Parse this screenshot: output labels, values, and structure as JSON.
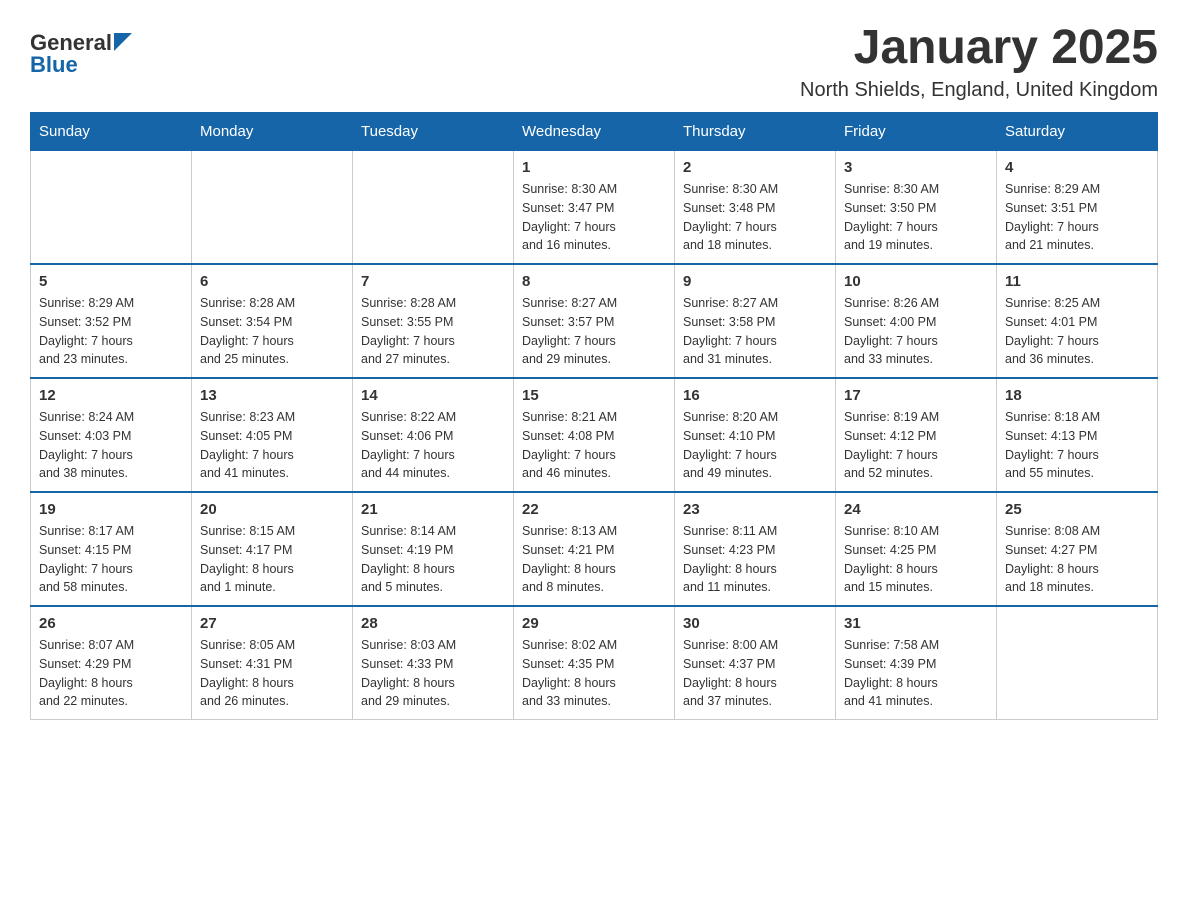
{
  "header": {
    "logo_general": "General",
    "logo_blue": "Blue",
    "title": "January 2025",
    "subtitle": "North Shields, England, United Kingdom"
  },
  "days_of_week": [
    "Sunday",
    "Monday",
    "Tuesday",
    "Wednesday",
    "Thursday",
    "Friday",
    "Saturday"
  ],
  "weeks": [
    [
      {
        "day": "",
        "info": ""
      },
      {
        "day": "",
        "info": ""
      },
      {
        "day": "",
        "info": ""
      },
      {
        "day": "1",
        "info": "Sunrise: 8:30 AM\nSunset: 3:47 PM\nDaylight: 7 hours\nand 16 minutes."
      },
      {
        "day": "2",
        "info": "Sunrise: 8:30 AM\nSunset: 3:48 PM\nDaylight: 7 hours\nand 18 minutes."
      },
      {
        "day": "3",
        "info": "Sunrise: 8:30 AM\nSunset: 3:50 PM\nDaylight: 7 hours\nand 19 minutes."
      },
      {
        "day": "4",
        "info": "Sunrise: 8:29 AM\nSunset: 3:51 PM\nDaylight: 7 hours\nand 21 minutes."
      }
    ],
    [
      {
        "day": "5",
        "info": "Sunrise: 8:29 AM\nSunset: 3:52 PM\nDaylight: 7 hours\nand 23 minutes."
      },
      {
        "day": "6",
        "info": "Sunrise: 8:28 AM\nSunset: 3:54 PM\nDaylight: 7 hours\nand 25 minutes."
      },
      {
        "day": "7",
        "info": "Sunrise: 8:28 AM\nSunset: 3:55 PM\nDaylight: 7 hours\nand 27 minutes."
      },
      {
        "day": "8",
        "info": "Sunrise: 8:27 AM\nSunset: 3:57 PM\nDaylight: 7 hours\nand 29 minutes."
      },
      {
        "day": "9",
        "info": "Sunrise: 8:27 AM\nSunset: 3:58 PM\nDaylight: 7 hours\nand 31 minutes."
      },
      {
        "day": "10",
        "info": "Sunrise: 8:26 AM\nSunset: 4:00 PM\nDaylight: 7 hours\nand 33 minutes."
      },
      {
        "day": "11",
        "info": "Sunrise: 8:25 AM\nSunset: 4:01 PM\nDaylight: 7 hours\nand 36 minutes."
      }
    ],
    [
      {
        "day": "12",
        "info": "Sunrise: 8:24 AM\nSunset: 4:03 PM\nDaylight: 7 hours\nand 38 minutes."
      },
      {
        "day": "13",
        "info": "Sunrise: 8:23 AM\nSunset: 4:05 PM\nDaylight: 7 hours\nand 41 minutes."
      },
      {
        "day": "14",
        "info": "Sunrise: 8:22 AM\nSunset: 4:06 PM\nDaylight: 7 hours\nand 44 minutes."
      },
      {
        "day": "15",
        "info": "Sunrise: 8:21 AM\nSunset: 4:08 PM\nDaylight: 7 hours\nand 46 minutes."
      },
      {
        "day": "16",
        "info": "Sunrise: 8:20 AM\nSunset: 4:10 PM\nDaylight: 7 hours\nand 49 minutes."
      },
      {
        "day": "17",
        "info": "Sunrise: 8:19 AM\nSunset: 4:12 PM\nDaylight: 7 hours\nand 52 minutes."
      },
      {
        "day": "18",
        "info": "Sunrise: 8:18 AM\nSunset: 4:13 PM\nDaylight: 7 hours\nand 55 minutes."
      }
    ],
    [
      {
        "day": "19",
        "info": "Sunrise: 8:17 AM\nSunset: 4:15 PM\nDaylight: 7 hours\nand 58 minutes."
      },
      {
        "day": "20",
        "info": "Sunrise: 8:15 AM\nSunset: 4:17 PM\nDaylight: 8 hours\nand 1 minute."
      },
      {
        "day": "21",
        "info": "Sunrise: 8:14 AM\nSunset: 4:19 PM\nDaylight: 8 hours\nand 5 minutes."
      },
      {
        "day": "22",
        "info": "Sunrise: 8:13 AM\nSunset: 4:21 PM\nDaylight: 8 hours\nand 8 minutes."
      },
      {
        "day": "23",
        "info": "Sunrise: 8:11 AM\nSunset: 4:23 PM\nDaylight: 8 hours\nand 11 minutes."
      },
      {
        "day": "24",
        "info": "Sunrise: 8:10 AM\nSunset: 4:25 PM\nDaylight: 8 hours\nand 15 minutes."
      },
      {
        "day": "25",
        "info": "Sunrise: 8:08 AM\nSunset: 4:27 PM\nDaylight: 8 hours\nand 18 minutes."
      }
    ],
    [
      {
        "day": "26",
        "info": "Sunrise: 8:07 AM\nSunset: 4:29 PM\nDaylight: 8 hours\nand 22 minutes."
      },
      {
        "day": "27",
        "info": "Sunrise: 8:05 AM\nSunset: 4:31 PM\nDaylight: 8 hours\nand 26 minutes."
      },
      {
        "day": "28",
        "info": "Sunrise: 8:03 AM\nSunset: 4:33 PM\nDaylight: 8 hours\nand 29 minutes."
      },
      {
        "day": "29",
        "info": "Sunrise: 8:02 AM\nSunset: 4:35 PM\nDaylight: 8 hours\nand 33 minutes."
      },
      {
        "day": "30",
        "info": "Sunrise: 8:00 AM\nSunset: 4:37 PM\nDaylight: 8 hours\nand 37 minutes."
      },
      {
        "day": "31",
        "info": "Sunrise: 7:58 AM\nSunset: 4:39 PM\nDaylight: 8 hours\nand 41 minutes."
      },
      {
        "day": "",
        "info": ""
      }
    ]
  ]
}
